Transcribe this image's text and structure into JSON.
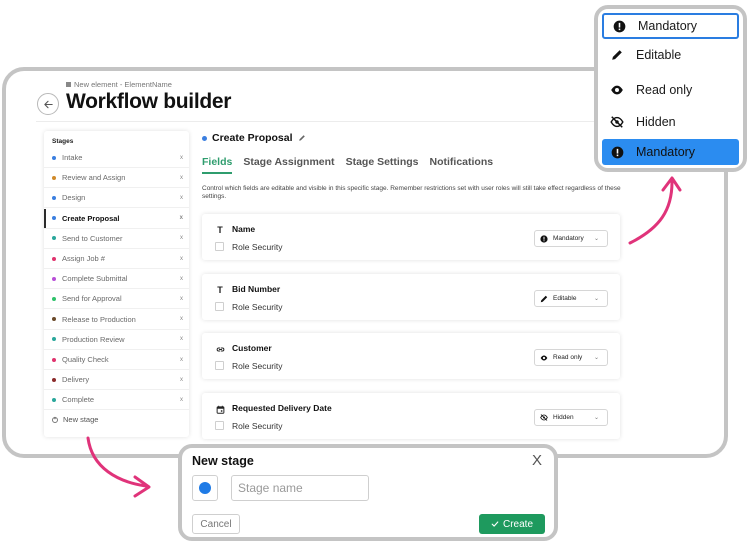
{
  "header": {
    "breadcrumb": "New element - ElementName",
    "title": "Workflow builder"
  },
  "sidebar": {
    "title": "Stages",
    "items": [
      {
        "label": "Intake",
        "color": "#3b7fe0"
      },
      {
        "label": "Review and Assign",
        "color": "#d08a2a"
      },
      {
        "label": "Design",
        "color": "#3b7fe0"
      },
      {
        "label": "Create Proposal",
        "color": "#3b7fe0",
        "active": true
      },
      {
        "label": "Send to Customer",
        "color": "#2aa79b"
      },
      {
        "label": "Assign Job #",
        "color": "#e0336e"
      },
      {
        "label": "Complete Submittal",
        "color": "#b84fd8"
      },
      {
        "label": "Send for Approval",
        "color": "#2ec26a"
      },
      {
        "label": "Release to Production",
        "color": "#6b4a2a"
      },
      {
        "label": "Production Review",
        "color": "#2aa79b"
      },
      {
        "label": "Quality Check",
        "color": "#e0336e"
      },
      {
        "label": "Delivery",
        "color": "#8b2a2a"
      },
      {
        "label": "Complete",
        "color": "#2aa79b"
      }
    ],
    "remove_glyph": "x",
    "new_stage_label": "New stage"
  },
  "stage_detail": {
    "title": "Create Proposal",
    "dot_color": "#3b7fe0",
    "tabs": [
      "Fields",
      "Stage Assignment",
      "Stage Settings",
      "Notifications"
    ],
    "description": "Control which fields are editable and visible in this specific stage. Remember restrictions set with user roles will still take effect regardless of these settings.",
    "fields": [
      {
        "name": "Name",
        "type_icon": "text-type-icon",
        "role_security": "Role Security",
        "permission": "Mandatory",
        "permission_icon": "alert-circle-icon"
      },
      {
        "name": "Bid Number",
        "type_icon": "text-type-icon",
        "role_security": "Role Security",
        "permission": "Editable",
        "permission_icon": "pencil-icon"
      },
      {
        "name": "Customer",
        "type_icon": "link-icon",
        "role_security": "Role Security",
        "permission": "Read only",
        "permission_icon": "eye-icon"
      },
      {
        "name": "Requested Delivery Date",
        "type_icon": "calendar-icon",
        "role_security": "Role Security",
        "permission": "Hidden",
        "permission_icon": "eye-off-icon"
      }
    ]
  },
  "permission_menu": {
    "current": "Mandatory",
    "options": [
      "Editable",
      "Read only",
      "Hidden",
      "Mandatory"
    ],
    "selected_color": "#2b8cf0"
  },
  "new_stage_modal": {
    "title": "New stage",
    "close_glyph": "X",
    "color": "#1f7be6",
    "name_placeholder": "Stage name",
    "cancel_label": "Cancel",
    "create_label": "Create",
    "create_color": "#1e9a5e"
  },
  "colors": {
    "accent": "#2f9d6e",
    "arrow": "#e0337a",
    "frame_border": "#c4c4c4"
  }
}
